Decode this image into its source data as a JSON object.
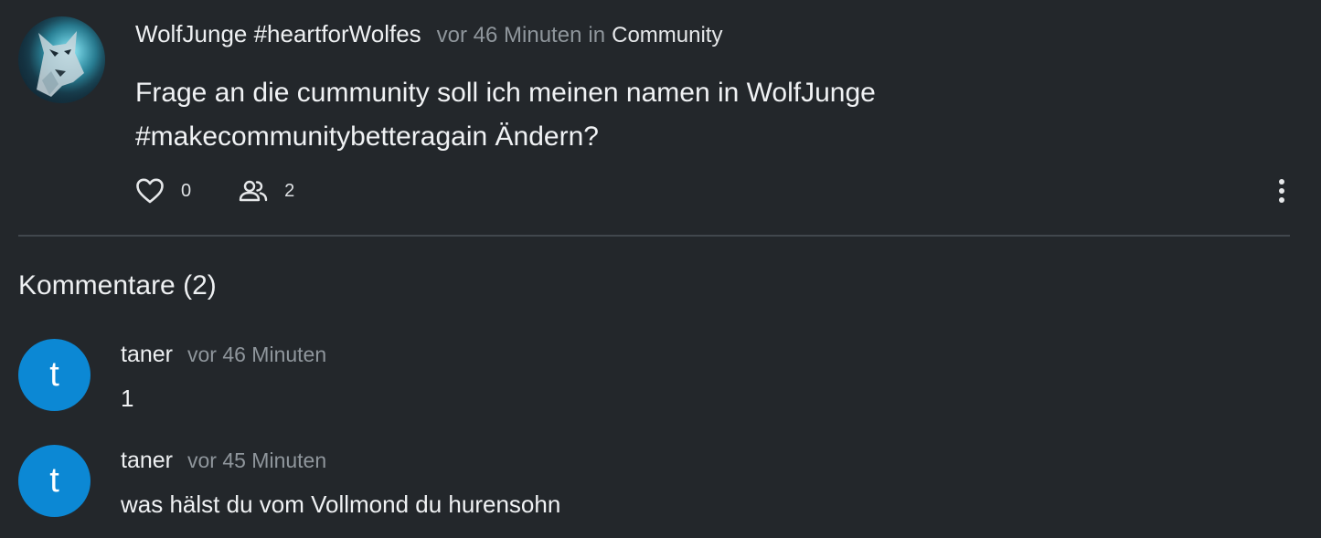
{
  "post": {
    "author": "WolfJunge #heartforWolfes",
    "time": "vor 46 Minuten",
    "in_label": "in",
    "community": "Community",
    "text": "Frage an die cummunity soll ich meinen namen in WolfJunge #makecommunitybetteragain Ändern?",
    "likes": "0",
    "participants": "2",
    "avatar_icon": "wolf-avatar"
  },
  "comments_section": {
    "title": "Kommentare (2)"
  },
  "comments": [
    {
      "initial": "t",
      "author": "taner",
      "time": "vor 46 Minuten",
      "text": "1",
      "avatar_color": "#0c88d4"
    },
    {
      "initial": "t",
      "author": "taner",
      "time": "vor 45 Minuten",
      "text": "was hälst du vom Vollmond du hurensohn",
      "avatar_color": "#0c88d4"
    }
  ],
  "colors": {
    "background": "#23272b",
    "muted_text": "#8f969c",
    "divider": "#41474d"
  },
  "icons": {
    "like": "heart-icon",
    "participants": "people-icon",
    "more": "more-vertical-icon"
  }
}
